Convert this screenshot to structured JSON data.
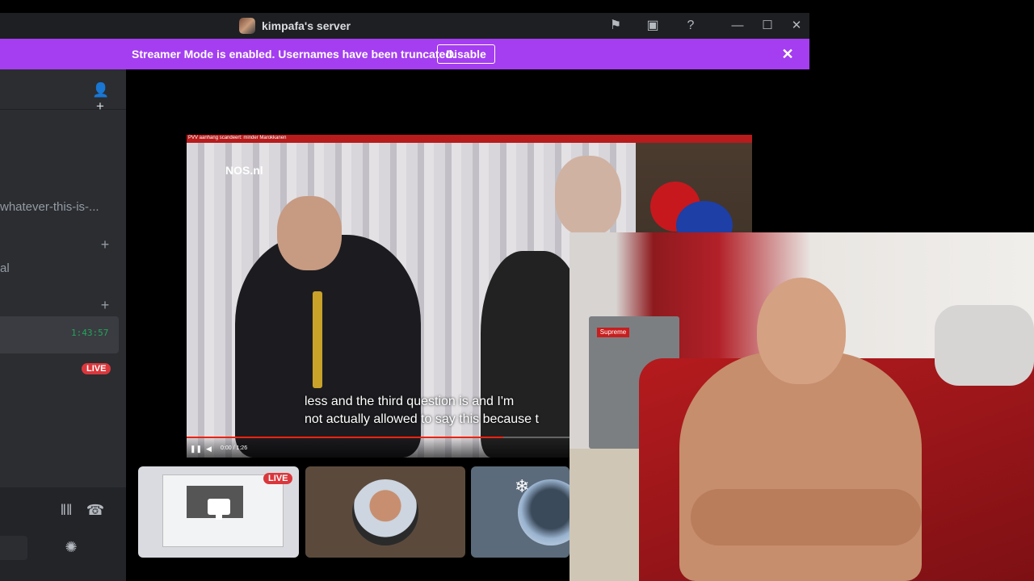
{
  "window": {
    "title": "kimpafa's server"
  },
  "banner": {
    "text": "Streamer Mode is enabled. Usernames have been truncated.",
    "button_label": "Disable"
  },
  "sidebar": {
    "channels": [
      {
        "label": "whatever-this-is-..."
      },
      {
        "label": "al"
      }
    ],
    "voice": {
      "timer": "1:43:57",
      "live_label": "LIVE"
    }
  },
  "screen": {
    "topbar_text": "PVV aanhang scandeert: minder Marokkanen",
    "logo": "NOS.nl",
    "subtitle_line1": "less and the third question is and I'm",
    "subtitle_line2": "not actually allowed to say this because t",
    "time": "0:00 / 1:26",
    "progress": 0.56
  },
  "thumbnails": {
    "live_label": "LIVE"
  },
  "webcam": {
    "fridge_label": "Supreme"
  },
  "colors": {
    "banner": "#a43ef0",
    "live": "#da373c",
    "timer": "#23a55a"
  }
}
